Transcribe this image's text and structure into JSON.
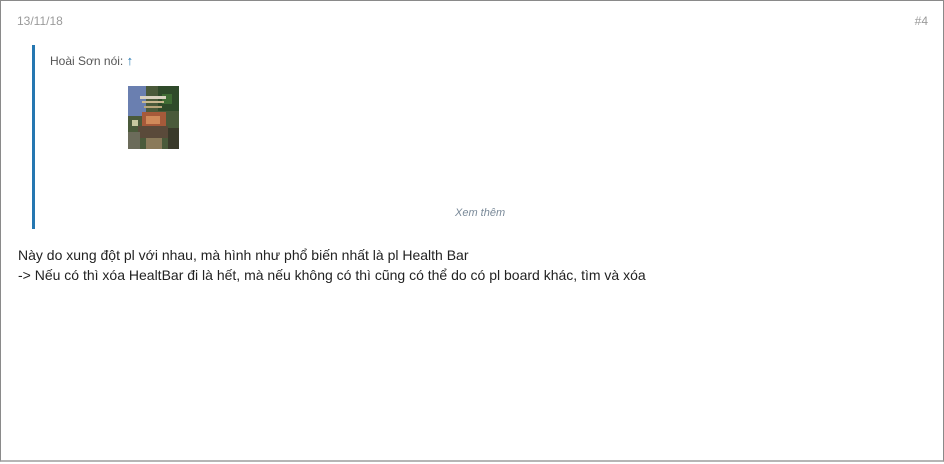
{
  "post": {
    "date": "13/11/18",
    "number": "#4"
  },
  "quote": {
    "author": "Hoài Sơn nói:",
    "arrow_icon": "↑",
    "see_more": "Xem thêm"
  },
  "message": {
    "line1": "Này do xung đột pl với nhau, mà hình như phổ biến nhất là pl Health Bar",
    "line2": "-> Nếu có thì xóa HealtBar đi là hết, mà nếu không có thì cũng có thể do có pl board khác, tìm và xóa"
  }
}
